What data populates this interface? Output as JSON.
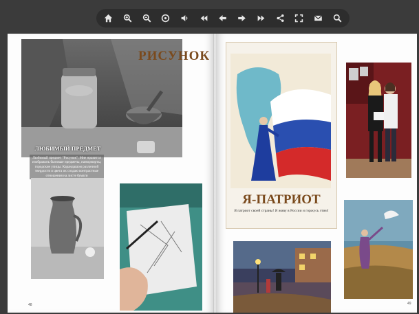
{
  "toolbar": {
    "buttons": [
      {
        "name": "home-button",
        "icon": "home-icon"
      },
      {
        "name": "zoom-in-button",
        "icon": "zoom-in-icon"
      },
      {
        "name": "zoom-out-button",
        "icon": "zoom-out-icon"
      },
      {
        "name": "fit-page-button",
        "icon": "fit-page-icon"
      },
      {
        "name": "sound-button",
        "icon": "speaker-icon"
      },
      {
        "name": "first-page-button",
        "icon": "double-left-icon"
      },
      {
        "name": "prev-page-button",
        "icon": "arrow-left-icon"
      },
      {
        "name": "next-page-button",
        "icon": "arrow-right-icon"
      },
      {
        "name": "last-page-button",
        "icon": "double-right-icon"
      },
      {
        "name": "share-button",
        "icon": "share-icon"
      },
      {
        "name": "fullscreen-button",
        "icon": "fullscreen-icon"
      },
      {
        "name": "email-button",
        "icon": "mail-icon"
      },
      {
        "name": "search-button",
        "icon": "search-icon"
      }
    ]
  },
  "left_page": {
    "heading": "РИСУНОК",
    "subheading": "ЛЮБИМЫЙ ПРЕДМЕТ",
    "caption": "Любимый предмет \"Рисунок\". Мне нравится изображать бытовые предметы, натюрморты, городские улицы. Карандашом различной твердости я цвета их создаю контрастные отношения на листе бумаги",
    "page_number": "48"
  },
  "right_page": {
    "heading": "Я-ПАТРИОТ",
    "caption": "Я патриот своей страны! Я живу в России и горжусь этим!",
    "page_number": "49"
  },
  "colors": {
    "heading_brown": "#7a4a1d",
    "flag_white": "#ffffff",
    "flag_blue": "#2a4fb0",
    "flag_red": "#d42a2a"
  }
}
